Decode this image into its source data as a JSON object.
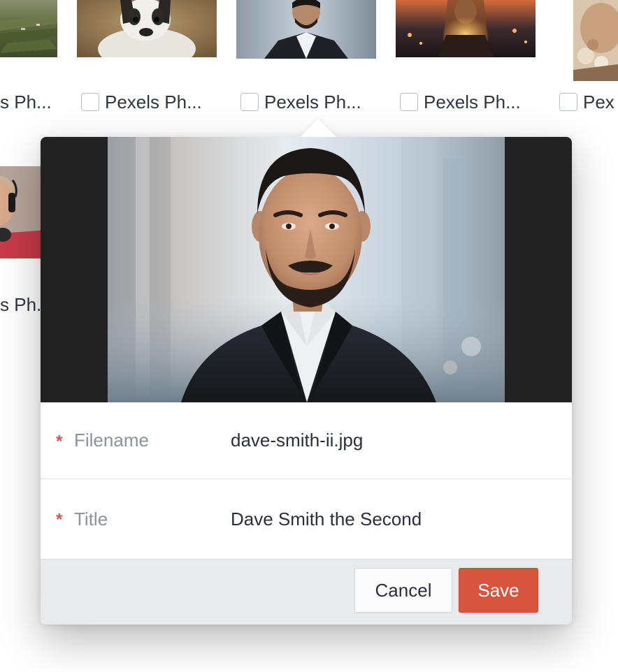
{
  "gallery": {
    "items": [
      {
        "label": "Pexels Ph...",
        "image": "countryside-landscape-photo",
        "checked": false
      },
      {
        "label": "Pexels Ph...",
        "image": "french-bulldog-photo",
        "checked": false
      },
      {
        "label": "Pexels Ph...",
        "image": "man-in-suit-photo",
        "checked": false
      },
      {
        "label": "Pexels Ph...",
        "image": "woman-city-lights-photo",
        "checked": false
      },
      {
        "label": "Pexels Ph...",
        "image": "person-flowers-photo",
        "checked": false
      },
      {
        "label": "Pexels Ph...",
        "image": "man-headphones-photo",
        "checked": false
      }
    ],
    "partial_labels": {
      "row1_left": "s Ph...",
      "row1_right": "Pex",
      "row2_left": "s Ph."
    }
  },
  "editor": {
    "preview_image": "man-in-suit-portrait",
    "fields": [
      {
        "label": "Filename",
        "value": "dave-smith-ii.jpg",
        "required": true,
        "required_mark": "*"
      },
      {
        "label": "Title",
        "value": "Dave Smith the Second",
        "required": true,
        "required_mark": "*"
      }
    ],
    "cancel_label": "Cancel",
    "save_label": "Save"
  },
  "colors": {
    "save_button": "#d7553f",
    "required_mark": "#d9534f",
    "preview_background": "#222222",
    "footer_background": "#e9eaec"
  }
}
